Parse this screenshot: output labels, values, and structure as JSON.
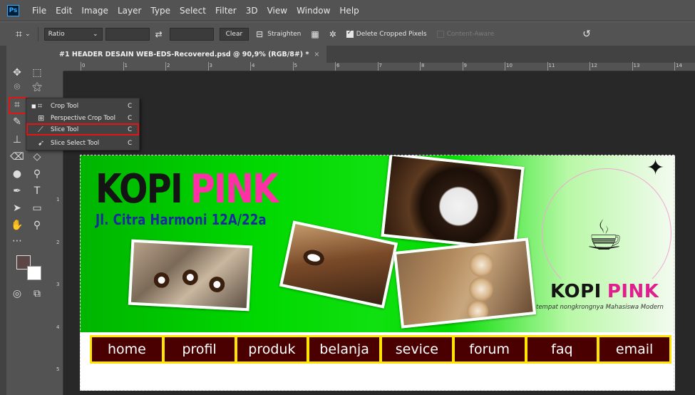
{
  "app": {
    "logo": "Ps"
  },
  "menu": [
    "File",
    "Edit",
    "Image",
    "Layer",
    "Type",
    "Select",
    "Filter",
    "3D",
    "View",
    "Window",
    "Help"
  ],
  "options": {
    "ratio_label": "Ratio",
    "clear_label": "Clear",
    "straighten_label": "Straighten",
    "delete_cropped_label": "Delete Cropped Pixels",
    "content_aware_label": "Content-Aware"
  },
  "document_tab": {
    "title": "#1 HEADER DESAIN WEB-EDS-Recovered.psd @ 90,9% (RGB/8#) *",
    "close": "×"
  },
  "ruler": {
    "h_ticks": [
      "0",
      "1",
      "2",
      "3",
      "4",
      "5",
      "6",
      "7",
      "8",
      "9",
      "10",
      "11",
      "12",
      "13",
      "14"
    ],
    "v_ticks": [
      "1",
      "2",
      "3",
      "4",
      "5"
    ]
  },
  "flyout": {
    "items": [
      {
        "label": "Crop Tool",
        "key": "C",
        "icon": "crop-icon",
        "active": true
      },
      {
        "label": "Perspective Crop Tool",
        "key": "C",
        "icon": "perspective-crop-icon",
        "active": false
      },
      {
        "label": "Slice Tool",
        "key": "C",
        "icon": "slice-icon",
        "active": false
      },
      {
        "label": "Slice Select Tool",
        "key": "C",
        "icon": "slice-select-icon",
        "active": false
      }
    ]
  },
  "banner": {
    "title_part1": "KOPI",
    "title_part2": "PINK",
    "address": "Jl. Citra Harmoni 12A/22a",
    "logo_part1": "KOPI",
    "logo_part2": "PINK",
    "tagline": "tempat nongkrongnya Mahasiswa Modern",
    "nav": [
      "home",
      "profil",
      "produk",
      "belanja",
      "sevice",
      "forum",
      "faq",
      "email"
    ]
  },
  "colors": {
    "pink": "#ff2fa6",
    "nav_bg": "#4a0000",
    "nav_border": "#ffe500",
    "highlight": "#e01616"
  }
}
